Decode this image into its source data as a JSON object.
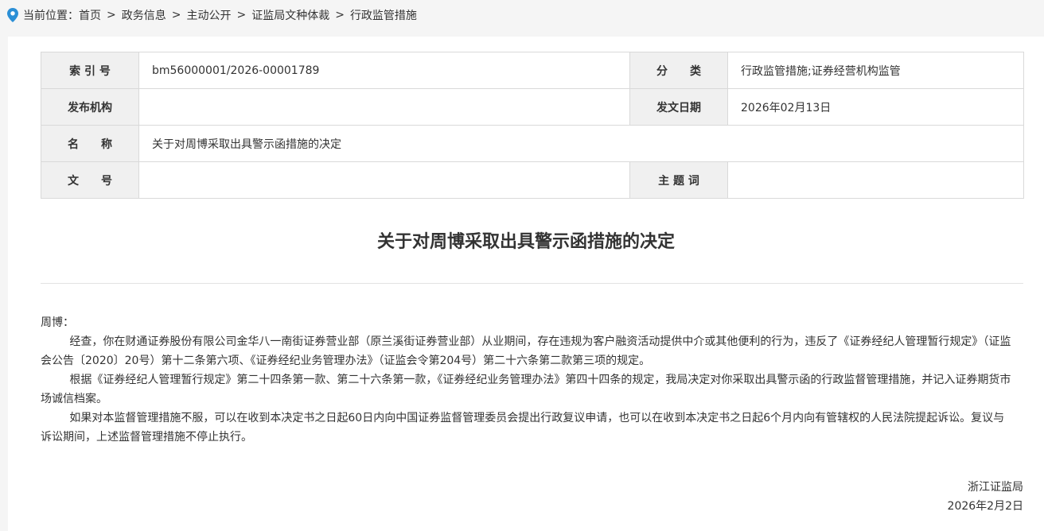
{
  "breadcrumb": {
    "prefix": "当前位置：",
    "items": [
      "首页",
      "政务信息",
      "主动公开",
      "证监局文种体裁",
      "行政监管措施"
    ],
    "separator": ">"
  },
  "meta": {
    "index_label": "索 引 号",
    "index_value": "bm56000001/2026-00001789",
    "category_label": "分　　类",
    "category_value": "行政监管措施;证券经营机构监管",
    "issuer_label": "发布机构",
    "issuer_value": "",
    "date_label": "发文日期",
    "date_value": "2026年02月13日",
    "name_label": "名　　称",
    "name_value": "关于对周博采取出具警示函措施的决定",
    "docno_label": "文　　号",
    "docno_value": "",
    "keywords_label": "主 题 词",
    "keywords_value": ""
  },
  "document": {
    "title": "关于对周博采取出具警示函措施的决定",
    "salutation": "周博：",
    "paragraphs": [
      "经查，你在财通证券股份有限公司金华八一南街证券营业部（原兰溪街证券营业部）从业期间，存在违规为客户融资活动提供中介或其他便利的行为，违反了《证券经纪人管理暂行规定》（证监会公告〔2020〕20号）第十二条第六项、《证券经纪业务管理办法》（证监会令第204号）第二十六条第二款第三项的规定。",
      "根据《证券经纪人管理暂行规定》第二十四条第一款、第二十六条第一款，《证券经纪业务管理办法》第四十四条的规定，我局决定对你采取出具警示函的行政监督管理措施，并记入证券期货市场诚信档案。",
      "如果对本监督管理措施不服，可以在收到本决定书之日起60日内向中国证券监督管理委员会提出行政复议申请，也可以在收到本决定书之日起6个月内向有管辖权的人民法院提起诉讼。复议与诉讼期间，上述监督管理措施不停止执行。"
    ],
    "signer": "浙江证监局",
    "sign_date": "2026年2月2日"
  },
  "colors": {
    "pin": "#2b8fd6",
    "label_bg": "#f0f0f0",
    "border": "#d9d9d9"
  }
}
